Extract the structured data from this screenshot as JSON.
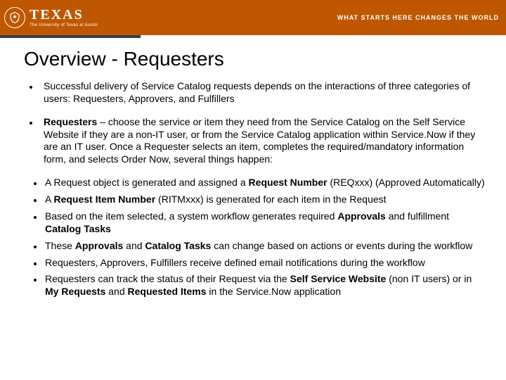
{
  "header": {
    "brand_main": "TEXAS",
    "brand_sub": "The University of Texas at Austin",
    "tagline": "WHAT STARTS HERE CHANGES THE WORLD"
  },
  "title": "Overview - Requesters",
  "primary": [
    {
      "runs": [
        {
          "t": "Successful delivery of Service Catalog requests depends on the interactions of three categories of users: Requesters, Approvers, and Fulfillers",
          "b": false
        }
      ]
    },
    {
      "runs": [
        {
          "t": "Requesters",
          "b": true
        },
        {
          "t": " – choose the service or item they need from the Service Catalog on the Self Service Website if they are a non-IT user, or from the Service Catalog application within Service.Now if they are an IT user. Once a Requester selects an item, completes the required/mandatory information form, and selects Order Now, several things happen:",
          "b": false
        }
      ]
    }
  ],
  "secondary": [
    {
      "runs": [
        {
          "t": "A Request object is generated and assigned a ",
          "b": false
        },
        {
          "t": "Request Number",
          "b": true
        },
        {
          "t": " (REQxxx) (Approved Automatically)",
          "b": false
        }
      ]
    },
    {
      "runs": [
        {
          "t": "A ",
          "b": false
        },
        {
          "t": "Request Item Number",
          "b": true
        },
        {
          "t": " (RITMxxx) is generated for each item in the Request",
          "b": false
        }
      ]
    },
    {
      "runs": [
        {
          "t": "Based on the item selected, a system workflow generates required ",
          "b": false
        },
        {
          "t": "Approvals",
          "b": true
        },
        {
          "t": " and fulfillment ",
          "b": false
        },
        {
          "t": "Catalog Tasks",
          "b": true
        }
      ]
    },
    {
      "runs": [
        {
          "t": "These ",
          "b": false
        },
        {
          "t": "Approvals",
          "b": true
        },
        {
          "t": " and ",
          "b": false
        },
        {
          "t": "Catalog Tasks",
          "b": true
        },
        {
          "t": " can change based on actions or events during the workflow",
          "b": false
        }
      ]
    },
    {
      "runs": [
        {
          "t": "Requesters, Approvers, Fulfillers receive defined email notifications during the workflow",
          "b": false
        }
      ]
    },
    {
      "runs": [
        {
          "t": "Requesters can track the status of their Request via the ",
          "b": false
        },
        {
          "t": "Self Service Website",
          "b": true
        },
        {
          "t": " (non IT users) or in ",
          "b": false
        },
        {
          "t": "My Requests",
          "b": true
        },
        {
          "t": " and ",
          "b": false
        },
        {
          "t": "Requested Items",
          "b": true
        },
        {
          "t": " in the Service.Now application",
          "b": false
        }
      ]
    }
  ]
}
